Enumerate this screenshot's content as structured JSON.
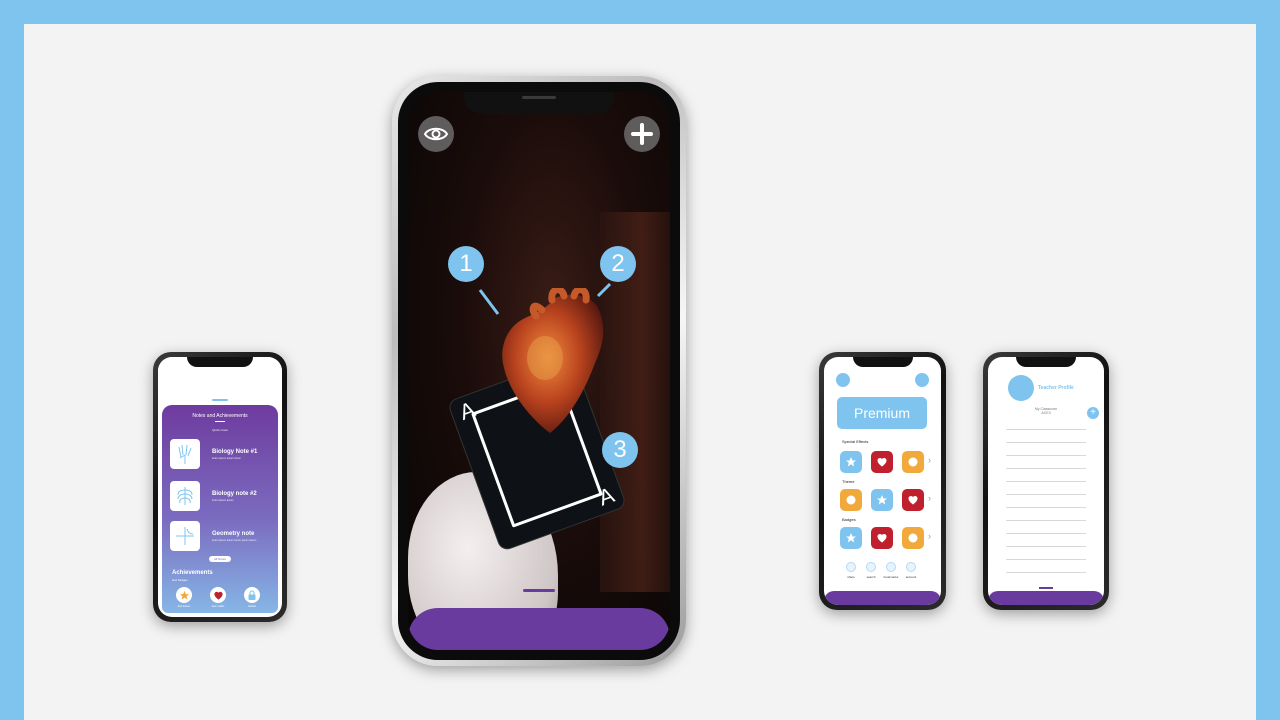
{
  "colors": {
    "frame": "#7ec4ef",
    "background": "#f3f3f3",
    "accent": "#7ec4ef",
    "purple": "#6a3b9e",
    "red": "#c0202e",
    "orange": "#f2a93b"
  },
  "notes_screen": {
    "title": "Notes and Achievements",
    "subtitle": "Quick notes",
    "notes": [
      {
        "title": "Biology Note #1",
        "desc": "lorem ipsum ipsum lorem",
        "icon": "hand-xray-icon"
      },
      {
        "title": "Biology note #2",
        "desc": "lorem ipsum ipsum",
        "icon": "ribcage-icon"
      },
      {
        "title": "Geometry note",
        "desc": "lorem ipsum ipsum lorem ipsum ipsum",
        "icon": "graph-icon"
      }
    ],
    "all_notes_label": "All Notes",
    "achievements_title": "Achievements",
    "achievements_sub": "and badges",
    "badges": [
      {
        "label": "first lesson",
        "icon": "star-icon"
      },
      {
        "label": "love maths",
        "icon": "heart-icon"
      },
      {
        "label": "locked",
        "icon": "lock-icon"
      }
    ]
  },
  "ar_screen": {
    "eye_button": "eye-icon",
    "add_button": "plus-icon",
    "callouts": [
      "1",
      "2",
      "3"
    ],
    "card_letter": "A"
  },
  "premium_screen": {
    "premium_label": "Premium",
    "sections": [
      "Special Effects",
      "Theme",
      "Badges"
    ],
    "nav": [
      "share",
      "search",
      "bookmarks",
      "account"
    ]
  },
  "teacher_screen": {
    "title": "Teacher Profile",
    "classroom": "My Classroom",
    "classroom_code": "ACE3"
  }
}
